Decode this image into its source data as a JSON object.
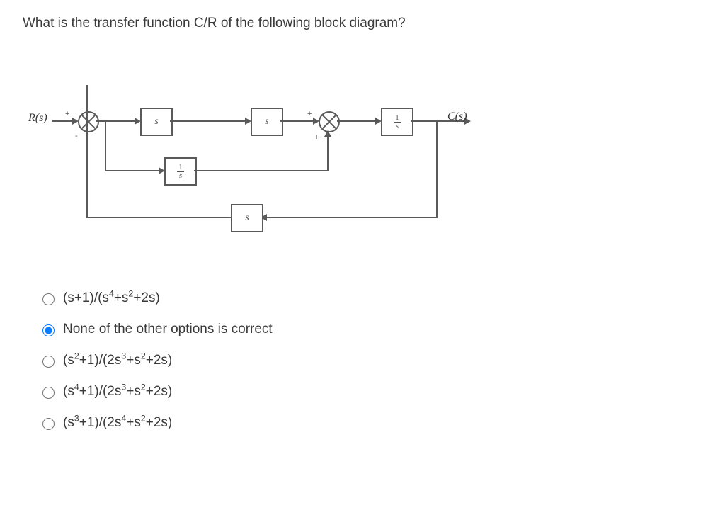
{
  "question": "What is the transfer function C/R of the following block diagram?",
  "diagram": {
    "input_label": "R(s)",
    "output_label": "C(s)",
    "block1": "s",
    "block2": "s",
    "block3_num": "1",
    "block3_den": "s",
    "feedback_inner_num": "1",
    "feedback_inner_den": "s",
    "feedback_outer": "s",
    "sign_Rplus": "+",
    "sign_Rminus": "-",
    "sign_midplus1": "+",
    "sign_midplus2": "+"
  },
  "options": [
    {
      "html": "(s+1)/(s<sup>4</sup>+s<sup>2</sup>+2s)",
      "selected": false
    },
    {
      "html": "None of the other options is correct",
      "selected": true
    },
    {
      "html": "(s<sup>2</sup>+1)/(2s<sup>3</sup>+s<sup>2</sup>+2s)",
      "selected": false
    },
    {
      "html": "(s<sup>4</sup>+1)/(2s<sup>3</sup>+s<sup>2</sup>+2s)",
      "selected": false
    },
    {
      "html": "(s<sup>3</sup>+1)/(2s<sup>4</sup>+s<sup>2</sup>+2s)",
      "selected": false
    }
  ]
}
